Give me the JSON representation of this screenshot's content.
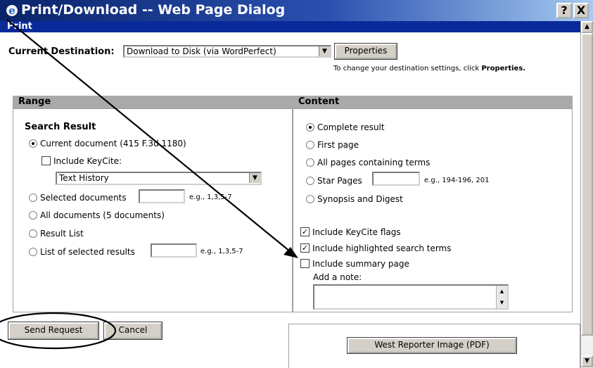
{
  "window": {
    "title": "Print/Download -- Web Page Dialog",
    "help_button": "?",
    "close_button": "X"
  },
  "print_bar": {
    "label": "Print"
  },
  "destination": {
    "label": "Current Destination:",
    "selected": "Download to Disk (via WordPerfect)",
    "properties_button": "Properties",
    "hint_prefix": "To change your destination settings, click ",
    "hint_bold": "Properties."
  },
  "range": {
    "header": "Range",
    "section_title": "Search Result",
    "current_document": "Current document (415 F.3d 1180)",
    "include_keycite": "Include KeyCite:",
    "keycite_selected": "Text History",
    "selected_documents": "Selected documents",
    "selected_documents_hint": "e.g., 1,3,5-7",
    "all_documents": "All documents (5 documents)",
    "result_list": "Result List",
    "list_selected_results": "List of selected results",
    "list_selected_results_hint": "e.g., 1,3,5-7"
  },
  "content": {
    "header": "Content",
    "complete_result": "Complete result",
    "first_page": "First page",
    "all_pages_terms": "All pages containing terms",
    "star_pages": "Star Pages",
    "star_pages_hint": "e.g., 194-196, 201",
    "synopsis": "Synopsis and Digest",
    "include_keycite_flags": "Include KeyCite flags",
    "include_highlighted": "Include highlighted search terms",
    "include_summary": "Include summary page",
    "add_note": "Add a note:"
  },
  "actions": {
    "send_request": "Send Request",
    "cancel": "Cancel",
    "west_reporter": "West Reporter Image (PDF)"
  },
  "colors": {
    "title_bar": "#0a246a",
    "print_bar": "#0a2a9a",
    "panel_header": "#a9a9a9",
    "button_face": "#d4d0c8"
  }
}
